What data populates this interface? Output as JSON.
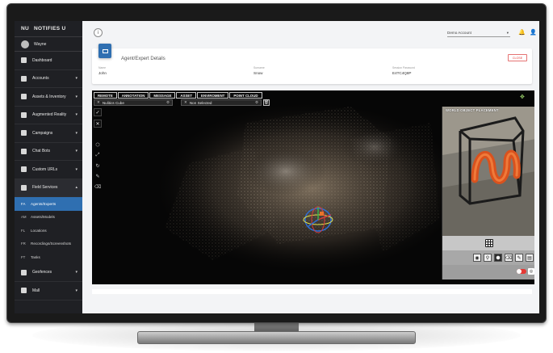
{
  "app": {
    "brand_abbr": "NU",
    "brand_name": "NOTIFIES U"
  },
  "user": {
    "name": "Wayne"
  },
  "sidebar": {
    "items": [
      {
        "label": "Dashboard",
        "icon": "dashboard-icon",
        "has_chevron": false
      },
      {
        "label": "Accounts",
        "icon": "accounts-icon",
        "has_chevron": true
      },
      {
        "label": "Assets & Inventory",
        "icon": "assets-icon",
        "has_chevron": true
      },
      {
        "label": "Augmented Reality",
        "icon": "ar-icon",
        "has_chevron": true
      },
      {
        "label": "Campaigns",
        "icon": "calendar-icon",
        "has_chevron": true
      },
      {
        "label": "Chat Bots",
        "icon": "chat-icon",
        "has_chevron": true
      },
      {
        "label": "Custom URLs",
        "icon": "link-icon",
        "has_chevron": true
      },
      {
        "label": "Field Services",
        "icon": "briefcase-icon",
        "has_chevron": true
      }
    ],
    "field_services_sub": [
      {
        "abbr": "FA",
        "label": "Agents/Experts",
        "active": true
      },
      {
        "abbr": "AM",
        "label": "Assets/Models",
        "active": false
      },
      {
        "abbr": "FL",
        "label": "Locations",
        "active": false
      },
      {
        "abbr": "FR",
        "label": "Recordings/Screenshots",
        "active": false
      },
      {
        "abbr": "FT",
        "label": "Tasks",
        "active": false
      }
    ],
    "bottom_items": [
      {
        "label": "Geofences",
        "icon": "geofence-icon"
      },
      {
        "label": "Mall",
        "icon": "mall-icon"
      }
    ]
  },
  "topbar": {
    "info": "i",
    "account_select": "Demo Account"
  },
  "details": {
    "title": "Agent/Expert Details",
    "close_label": "CLOSE",
    "fields": [
      {
        "label": "Name",
        "value": "John"
      },
      {
        "label": "Surname",
        "value": "Snow"
      },
      {
        "label": "Session Password",
        "value": "E4TC4Q8P"
      }
    ]
  },
  "viewer": {
    "tabs": [
      "REMOTE",
      "ANNOTATION",
      "MESSAGE",
      "ASSET",
      "ENVIROMENT",
      "POINT CLOUD"
    ],
    "selects": [
      "Nulitics Cube",
      "Non Selected"
    ],
    "phone_title": "WORLD OBJECT PLACEMENT"
  },
  "colors": {
    "accent": "#2f6fb1",
    "sidebar_bg": "#1f2024",
    "close_red": "#e53935"
  }
}
